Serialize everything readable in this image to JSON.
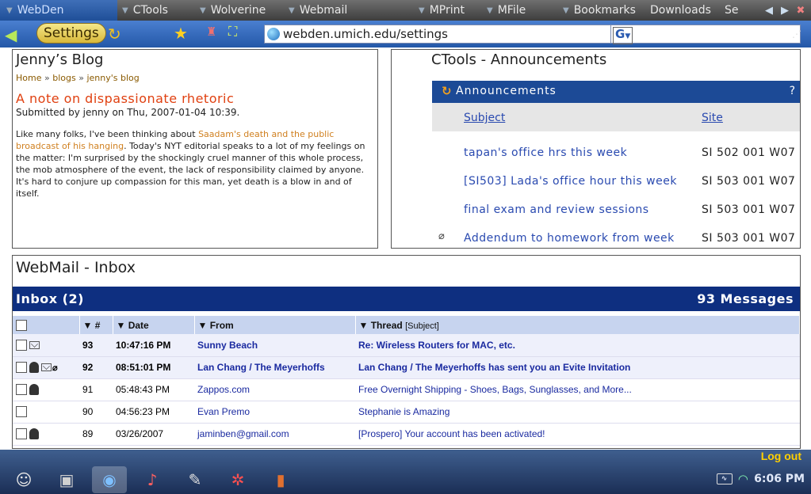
{
  "tabs": [
    {
      "label": "WebDen",
      "active": true
    },
    {
      "label": "CTools"
    },
    {
      "label": "Wolverine"
    },
    {
      "label": "Webmail"
    },
    {
      "label": "MPrint"
    },
    {
      "label": "MFile"
    },
    {
      "label": "Bookmarks"
    },
    {
      "label": "Downloads"
    },
    {
      "label": "Se"
    }
  ],
  "toolbar": {
    "settings_label": "Settings",
    "url": "webden.umich.edu/settings",
    "search_engine": "G"
  },
  "blog": {
    "title": "Jenny’s Blog",
    "breadcrumb": [
      "Home",
      "blogs",
      "jenny's blog"
    ],
    "breadcrumb_sep": "»",
    "post_title": "A note on dispassionate rhetoric",
    "submitted": "Submitted by jenny on Thu, 2007-01-04 10:39.",
    "body_pre": "Like many folks, I've been thinking about ",
    "body_link": "Saadam's death and the public broadcast of his hanging",
    "body_post": ". Today's NYT editorial speaks to a lot of my feelings on the matter: I'm surprised by the shockingly cruel manner of this whole process, the mob atmosphere of the event, the lack of responsibility claimed by anyone. It's hard to conjure up compassion for this man, yet death is a blow in and of itself."
  },
  "ctools": {
    "title": "CTools - Announcements",
    "header_label": "Announcements",
    "help": "?",
    "col_subject": "Subject",
    "col_site": "Site",
    "rows": [
      {
        "subject": "tapan's office hrs this week",
        "site": "SI 502 001 W07",
        "attachment": false
      },
      {
        "subject": "[SI503] Lada's office hour this week",
        "site": "SI 503 001 W07",
        "attachment": false
      },
      {
        "subject": "final exam and review sessions",
        "site": "SI 503 001 W07",
        "attachment": false
      },
      {
        "subject": "Addendum to homework from week",
        "site": "SI 503 001 W07",
        "attachment": true
      }
    ]
  },
  "webmail": {
    "title": "WebMail - Inbox",
    "inbox_label": "Inbox (2)",
    "message_count": "93 Messages",
    "columns": {
      "num": "▼ #",
      "date": "▼ Date",
      "from": "▼ From",
      "thread": "▼ Thread",
      "subject_hint": "[Subject]"
    },
    "rows": [
      {
        "num": "93",
        "date": "10:47:16 PM",
        "from": "Sunny Beach",
        "subject": "Re: Wireless Routers for MAC, etc.",
        "unread": true,
        "icons": [
          "mail"
        ]
      },
      {
        "num": "92",
        "date": "08:51:01 PM",
        "from": "Lan Chang / The Meyerhoffs",
        "subject": "Lan Chang / The Meyerhoffs has sent you an Evite Invitation",
        "unread": true,
        "icons": [
          "person",
          "mail",
          "attachment"
        ]
      },
      {
        "num": "91",
        "date": "05:48:43 PM",
        "from": "Zappos.com",
        "subject": "Free Overnight Shipping - Shoes, Bags, Sunglasses, and More...",
        "unread": false,
        "icons": [
          "person"
        ]
      },
      {
        "num": "90",
        "date": "04:56:23 PM",
        "from": "Evan Premo",
        "subject": "Stephanie is Amazing",
        "unread": false,
        "icons": []
      },
      {
        "num": "89",
        "date": "03/26/2007",
        "from": "jaminben@gmail.com",
        "subject": "[Prospero] Your account has been activated!",
        "unread": false,
        "icons": [
          "person"
        ]
      }
    ]
  },
  "bottom": {
    "logout": "Log out",
    "time": "6:06 PM",
    "apps": [
      "contacts-icon",
      "media-icon",
      "web-browser-icon",
      "guitar-icon",
      "pencil-icon",
      "game-icon",
      "book-icon"
    ]
  },
  "colors": {
    "tab_active": "#2458a8",
    "toolbar": "#2458a8",
    "inbox_header": "#0e2f80",
    "announcement_header": "#1c4a96",
    "post_title": "#e04010"
  }
}
